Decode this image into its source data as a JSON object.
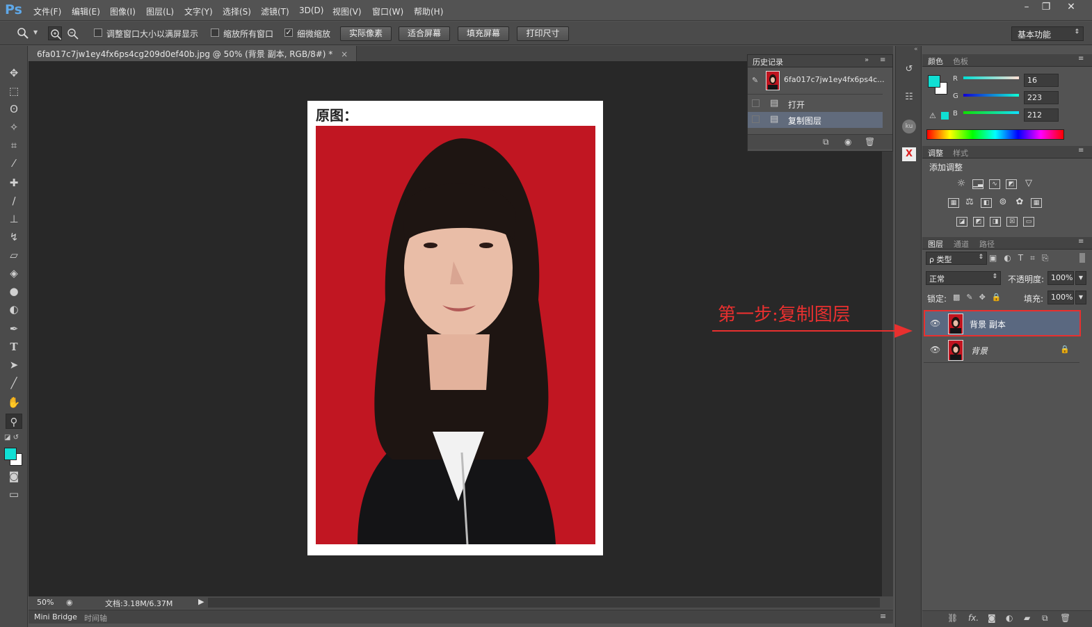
{
  "app": {
    "logo": "Ps"
  },
  "menu": [
    "文件(F)",
    "编辑(E)",
    "图像(I)",
    "图层(L)",
    "文字(Y)",
    "选择(S)",
    "滤镜(T)",
    "3D(D)",
    "视图(V)",
    "窗口(W)",
    "帮助(H)"
  ],
  "window_controls": {
    "minimize": "–",
    "restore": "❐",
    "close": "✕"
  },
  "options": {
    "resize_windows": "调整窗口大小以满屏显示",
    "zoom_all": "缩放所有窗口",
    "scrubby_zoom": "细微缩放",
    "scrubby_zoom_checked": true,
    "btn_actual": "实际像素",
    "btn_fit": "适合屏幕",
    "btn_fill": "填充屏幕",
    "btn_print": "打印尺寸",
    "workspace": "基本功能"
  },
  "document": {
    "tab_title": "6fa017c7jw1ey4fx6ps4cg209d0ef40b.jpg @ 50% (背景 副本, RGB/8#) *",
    "tab_close": "×",
    "heading": "原图："
  },
  "status": {
    "zoom": "50%",
    "doc_size": "文档:3.18M/6.37M"
  },
  "bottom_tabs": [
    "Mini Bridge",
    "时间轴"
  ],
  "history": {
    "tab": "历史记录",
    "snapshot": "6fa017c7jw1ey4fx6ps4c...",
    "items": [
      "打开",
      "复制图层"
    ]
  },
  "color_panel": {
    "tabs": [
      "颜色",
      "色板"
    ],
    "r_label": "R",
    "r": 16,
    "g_label": "G",
    "g": 223,
    "b_label": "B",
    "b": 212,
    "foreground": "#10dfd4"
  },
  "adjust_panel": {
    "tabs": [
      "调整",
      "样式"
    ],
    "add_label": "添加调整"
  },
  "layers_panel": {
    "tabs": [
      "图层",
      "通道",
      "路径"
    ],
    "filter": "ρ 类型",
    "blend_mode": "正常",
    "opacity_label": "不透明度:",
    "opacity": "100%",
    "lock_label": "锁定:",
    "fill_label": "填充:",
    "fill": "100%",
    "layers": [
      {
        "name": "背景 副本",
        "selected": true
      },
      {
        "name": "背景",
        "selected": false
      }
    ]
  },
  "annotation": {
    "text": "第一步:复制图层",
    "color": "#e8302f"
  }
}
